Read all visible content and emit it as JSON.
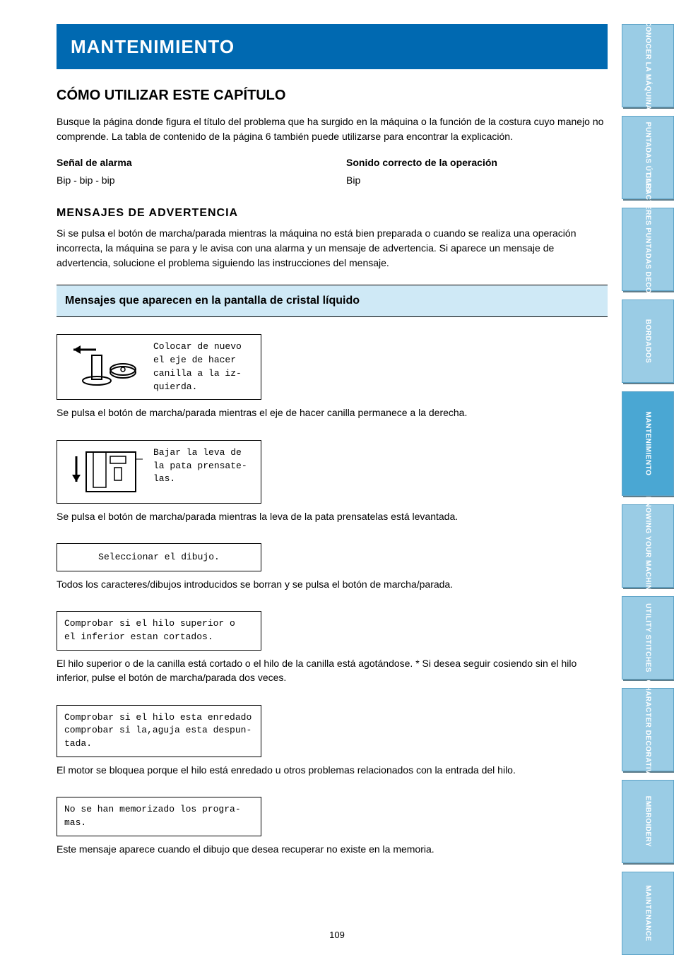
{
  "topbar": {
    "title": "MANTENIMIENTO"
  },
  "howto": {
    "header": "CÓMO UTILIZAR ESTE CAPÍTULO",
    "intro": "Busque la página donde figura el título del problema que ha surgido en la máquina o la función de la costura cuyo manejo no comprende. La tabla de contenido de la página 6 también puede utilizarse para encontrar la explicación."
  },
  "bumps": {
    "left_label": "Señal de alarma",
    "right_label": "Sonido correcto de la operación",
    "left_sound": "Bip - bip - bip",
    "right_sound": "Bip"
  },
  "warning": {
    "title": "MENSAJES DE ADVERTENCIA",
    "text": "Si se pulsa el botón de marcha/parada mientras la máquina no está bien preparada o cuando se realiza una operación incorrecta, la máquina se para y le avisa con una alarma y un mensaje de advertencia. Si aparece un mensaje de advertencia, solucione el problema siguiendo las instrucciones del mensaje."
  },
  "band": {
    "text": "Mensajes que aparecen en la pantalla de cristal líquido"
  },
  "messages": [
    {
      "display": "Colocar de nuevo\nel eje de hacer\ncanilla a la iz-\nquierda.",
      "illus": "bobbin",
      "explain": "Se pulsa el botón de marcha/parada mientras el eje de hacer canilla permanece a la derecha."
    },
    {
      "display": "Bajar la leva de\nla pata prensate-\nlas.",
      "illus": "foot",
      "explain": "Se pulsa el botón de marcha/parada mientras la leva de la pata prensatelas está levantada."
    },
    {
      "display": "Seleccionar el dibujo.",
      "illus": null,
      "center": true,
      "explain": "Todos los caracteres/dibujos introducidos se borran y se pulsa el botón de marcha/parada."
    },
    {
      "display": "Comprobar si el hilo superior o\nel inferior estan cortados.",
      "illus": null,
      "explain": "El hilo superior o de la canilla está cortado o el hilo de la canilla está agotándose.\n* Si desea seguir cosiendo sin el hilo inferior, pulse el botón de marcha/parada dos veces."
    },
    {
      "display": "Comprobar si el hilo esta enredado\ncomprobar si la,aguja esta despun-\ntada.",
      "illus": null,
      "explain": "El motor se bloquea porque el hilo está enredado u otros problemas relacionados con la entrada del hilo."
    },
    {
      "display": "No se han memorizado los progra-\nmas.",
      "illus": null,
      "explain": "Este mensaje aparece cuando el dibujo que desea recuperar no existe en la memoria."
    }
  ],
  "tabs": [
    "CONOCER LA MÁQUINA",
    "PUNTADAS ÚTILES",
    "CARACTERES PUNTADAS DECORATIVAS",
    "BORDADOS",
    "MANTENIMIENTO",
    "KNOWING YOUR MACHINE",
    "UTILITY STITCHES",
    "CHARACTER DECORATIVE",
    "EMBROIDERY",
    "MAINTENANCE"
  ],
  "active_tab_index": 4,
  "page_number": "109"
}
